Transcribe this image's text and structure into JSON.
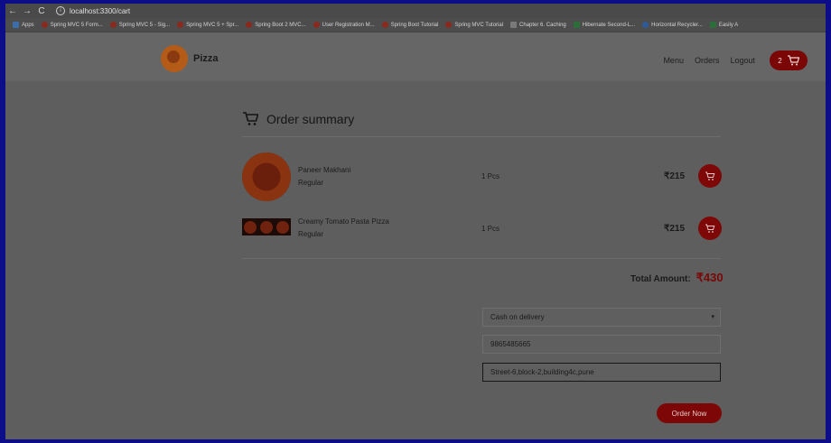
{
  "browser": {
    "url": "localhost:3300/cart",
    "bookmarks": [
      {
        "label": "Apps",
        "icon": "apps-grid-icon"
      },
      {
        "label": "Spring MVC 5 Form...",
        "icon": "bookmark-icon"
      },
      {
        "label": "Spring MVC 5 - Sig...",
        "icon": "bookmark-icon"
      },
      {
        "label": "Spring MVC 5 + Spr...",
        "icon": "bookmark-icon"
      },
      {
        "label": "Spring Boot 2 MVC...",
        "icon": "bookmark-icon"
      },
      {
        "label": "User Registration M...",
        "icon": "bookmark-icon"
      },
      {
        "label": "Spring Boot Tutorial",
        "icon": "bookmark-icon"
      },
      {
        "label": "Spring MVC Tutorial",
        "icon": "bookmark-icon"
      },
      {
        "label": "Chapter 6. Caching",
        "icon": "bookmark-icon"
      },
      {
        "label": "Hibernate Second-L...",
        "icon": "bookmark-icon"
      },
      {
        "label": "Horizontal Recycler...",
        "icon": "bookmark-icon"
      },
      {
        "label": "Easily A",
        "icon": "bookmark-icon"
      }
    ]
  },
  "header": {
    "brand": "Pizza",
    "nav": [
      "Menu",
      "Orders",
      "Logout"
    ],
    "cart_count": "2"
  },
  "summary": {
    "title": "Order summary",
    "items": [
      {
        "name": "Paneer Makhani",
        "size": "Regular",
        "qty": "1 Pcs",
        "price": "₹215"
      },
      {
        "name": "Creamy Tomato Pasta Pizza",
        "size": "Regular",
        "qty": "1 Pcs",
        "price": "₹215"
      }
    ],
    "total_label": "Total Amount:",
    "total_amount": "₹430"
  },
  "form": {
    "payment_selected": "Cash on delivery",
    "phone": "9865485665",
    "address": "Street-6,block-2,building4c,pune",
    "order_button": "Order Now"
  },
  "colors": {
    "accent": "#7d0707",
    "overlay_background": "#5e5e5e"
  }
}
